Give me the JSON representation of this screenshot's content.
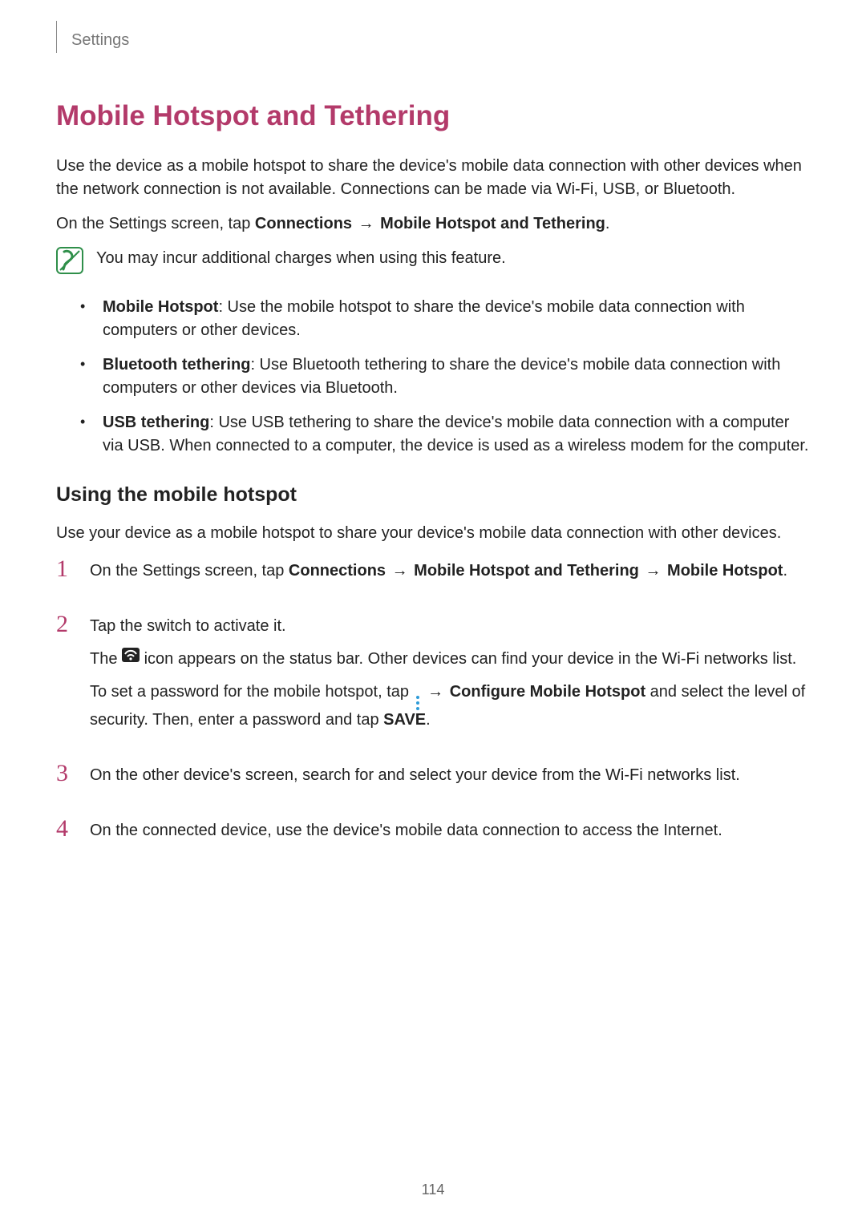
{
  "header": {
    "breadcrumb": "Settings"
  },
  "arrow": "→",
  "title": "Mobile Hotspot and Tethering",
  "intro": "Use the device as a mobile hotspot to share the device's mobile data connection with other devices when the network connection is not available. Connections can be made via Wi-Fi, USB, or Bluetooth.",
  "nav_prefix": "On the Settings screen, tap ",
  "nav_bold1": "Connections",
  "nav_bold2": "Mobile Hotspot and Tethering",
  "note_text": "You may incur additional charges when using this feature.",
  "bullets": [
    {
      "title": "Mobile Hotspot",
      "text": ": Use the mobile hotspot to share the device's mobile data connection with computers or other devices."
    },
    {
      "title": "Bluetooth tethering",
      "text": ": Use Bluetooth tethering to share the device's mobile data connection with computers or other devices via Bluetooth."
    },
    {
      "title": "USB tethering",
      "text": ": Use USB tethering to share the device's mobile data connection with a computer via USB. When connected to a computer, the device is used as a wireless modem for the computer."
    }
  ],
  "subheading": "Using the mobile hotspot",
  "sub_intro": "Use your device as a mobile hotspot to share your device's mobile data connection with other devices.",
  "steps": {
    "s1": {
      "num": "1",
      "prefix": "On the Settings screen, tap ",
      "b1": "Connections",
      "b2": "Mobile Hotspot and Tethering",
      "b3": "Mobile Hotspot",
      "suffix": "."
    },
    "s2": {
      "num": "2",
      "p1": "Tap the switch to activate it.",
      "p2a": "The ",
      "p2b": " icon appears on the status bar. Other devices can find your device in the Wi-Fi networks list.",
      "p3a": "To set a password for the mobile hotspot, tap ",
      "p3b_bold": "Configure Mobile Hotspot",
      "p3c": " and select the level of security. Then, enter a password and tap ",
      "p3d_bold": "SAVE",
      "p3e": "."
    },
    "s3": {
      "num": "3",
      "text": "On the other device's screen, search for and select your device from the Wi-Fi networks list."
    },
    "s4": {
      "num": "4",
      "text": "On the connected device, use the device's mobile data connection to access the Internet."
    }
  },
  "page_number": "114"
}
